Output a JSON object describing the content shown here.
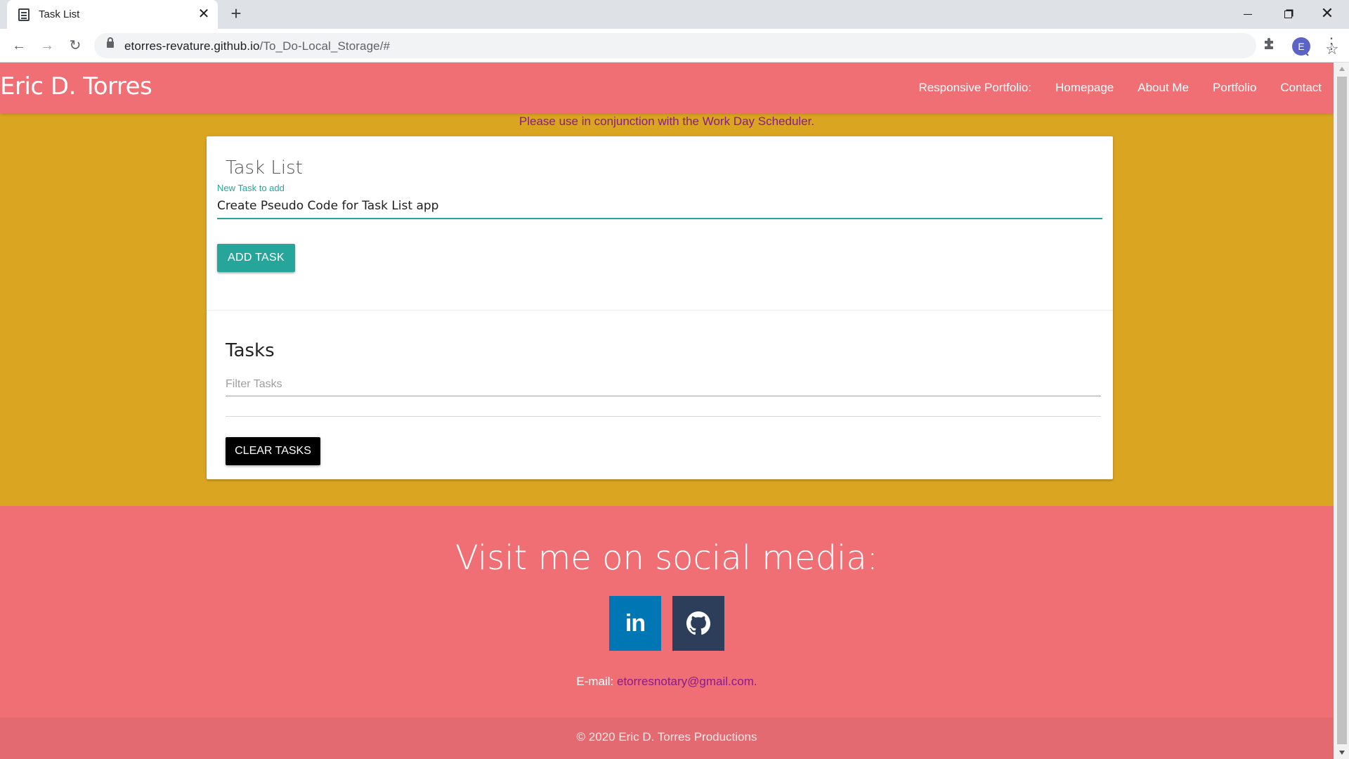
{
  "browser": {
    "tab_title": "Task List",
    "url_host": "etorres-revature.github.io",
    "url_path": "/To_Do-Local_Storage/#",
    "profile_initial": "E"
  },
  "header": {
    "brand": "Eric D. Torres",
    "nav_label": "Responsive Portfolio:",
    "nav_items": [
      "Homepage",
      "About Me",
      "Portfolio",
      "Contact"
    ]
  },
  "notice": "Please use in conjunction with the Work Day Scheduler.",
  "task_form": {
    "title": "Task List",
    "input_label": "New Task to add",
    "input_value": "Create Pseudo Code for Task List app",
    "add_button": "ADD TASK"
  },
  "tasks": {
    "title": "Tasks",
    "filter_placeholder": "Filter Tasks",
    "clear_button": "CLEAR TASKS"
  },
  "footer": {
    "heading": "Visit me on social media:",
    "linkedin_label": "in",
    "email_prefix": "E-mail: ",
    "email": "etorresnotary@gmail.com.",
    "copyright": "© 2020 Eric D. Torres Productions"
  },
  "colors": {
    "header_bg": "#ef6f74",
    "page_bg": "#daa520",
    "accent": "#26a69a",
    "link": "#8b1a8b",
    "linkedin": "#0077b5",
    "github": "#2c3e5a"
  },
  "icons": [
    "document-icon",
    "close-icon",
    "plus-icon",
    "back-icon",
    "forward-icon",
    "reload-icon",
    "lock-icon",
    "zoom-icon",
    "star-icon",
    "extensions-icon",
    "menu-icon",
    "linkedin-icon",
    "github-icon"
  ]
}
